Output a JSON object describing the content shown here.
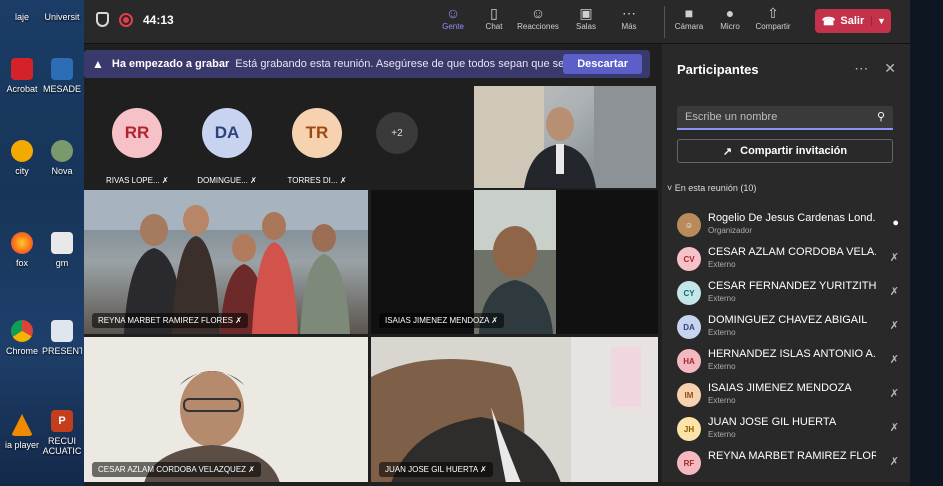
{
  "desktop": {
    "icons": [
      {
        "label": "laje"
      },
      {
        "label": "Universit"
      },
      {
        "label": "Acrobat"
      },
      {
        "label": "MESADE"
      },
      {
        "label": "city"
      },
      {
        "label": "Nova"
      },
      {
        "label": "fox"
      },
      {
        "label": "gm"
      },
      {
        "label": "Chrome"
      },
      {
        "label": "PRESENT"
      },
      {
        "label": "ia player"
      },
      {
        "label": "RECUI ACUATIC"
      }
    ]
  },
  "topbar": {
    "timer": "44:13",
    "buttons": [
      {
        "label": "Gente",
        "icon": "people-icon"
      },
      {
        "label": "Chat",
        "icon": "chat-icon"
      },
      {
        "label": "Reacciones",
        "icon": "reactions-icon"
      },
      {
        "label": "Salas",
        "icon": "rooms-icon"
      },
      {
        "label": "Más",
        "icon": "more-icon"
      },
      {
        "label": "Cámara",
        "icon": "camera-icon"
      },
      {
        "label": "Micro",
        "icon": "mic-icon"
      },
      {
        "label": "Compartir",
        "icon": "share-icon"
      }
    ],
    "leave_label": "Salir"
  },
  "banner": {
    "bold": "Ha empezado a grabar",
    "message": "Está grabando esta reunión. Asegúrese de que todos sepan que se...",
    "dismiss_label": "Descartar"
  },
  "avatars": [
    {
      "initials": "RR",
      "name": "RIVAS LOPE...",
      "bg": "#f6c1c7",
      "fg": "#b4232c"
    },
    {
      "initials": "DA",
      "name": "DOMINGUE...",
      "bg": "#c7d3ef",
      "fg": "#30427d"
    },
    {
      "initials": "TR",
      "name": "TORRES DI...",
      "bg": "#f7d2b0",
      "fg": "#9c4a12"
    }
  ],
  "more_count": "+2",
  "tiles": [
    {
      "name": "REYNA MARBET RAMIREZ FLORES"
    },
    {
      "name": "ISAIAS JIMENEZ MENDOZA"
    },
    {
      "name": "CESAR AZLAM CORDOBA VELAZQUEZ"
    },
    {
      "name": "JUAN JOSE GIL HUERTA"
    }
  ],
  "panel": {
    "title": "Participantes",
    "search_placeholder": "Escribe un nombre",
    "invite_label": "Compartir invitación",
    "section_label": "En esta reunión (10)",
    "participants": [
      {
        "initials": "",
        "name": "Rogelio De Jesus Cardenas Lond...",
        "role": "Organizador",
        "bg": "#b98b5a",
        "fg": "#fff",
        "mic": "mic-on"
      },
      {
        "initials": "CV",
        "name": "CESAR AZLAM CORDOBA VELA...",
        "role": "Externo",
        "bg": "#f6c1c7",
        "fg": "#a4262c",
        "mic": "mic-off"
      },
      {
        "initials": "CY",
        "name": "CESAR FERNANDEZ YURITZITH",
        "role": "Externo",
        "bg": "#c5e6e9",
        "fg": "#0b6a74",
        "mic": "mic-off"
      },
      {
        "initials": "DA",
        "name": "DOMINGUEZ CHAVEZ ABIGAIL",
        "role": "Externo",
        "bg": "#c7d3ef",
        "fg": "#30427d",
        "mic": "mic-off"
      },
      {
        "initials": "HA",
        "name": "HERNANDEZ ISLAS ANTONIO A...",
        "role": "Externo",
        "bg": "#f4b8c0",
        "fg": "#a4262c",
        "mic": "mic-off"
      },
      {
        "initials": "IM",
        "name": "ISAIAS JIMENEZ MENDOZA",
        "role": "Externo",
        "bg": "#f7d2b0",
        "fg": "#9c4a12",
        "mic": "mic-off"
      },
      {
        "initials": "JH",
        "name": "JUAN JOSE GIL HUERTA",
        "role": "Externo",
        "bg": "#fde3a7",
        "fg": "#8a5a00",
        "mic": "mic-off"
      },
      {
        "initials": "RF",
        "name": "REYNA MARBET RAMIREZ FLORES",
        "role": "",
        "bg": "#f4b8c0",
        "fg": "#a4262c",
        "mic": "mic-off"
      }
    ]
  }
}
